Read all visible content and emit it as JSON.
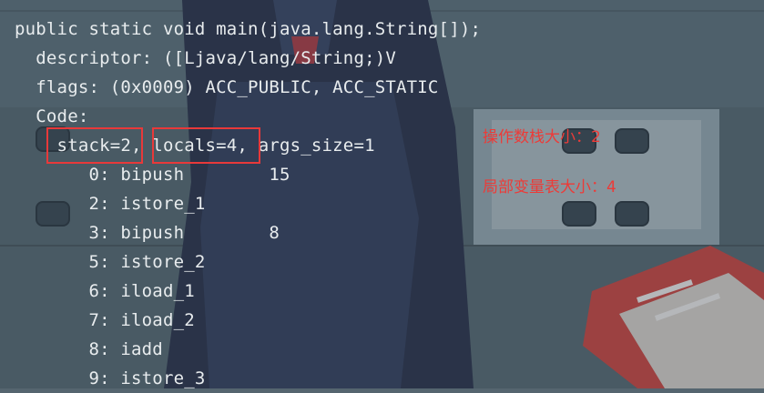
{
  "code": {
    "lines": [
      "public static void main(java.lang.String[]);",
      "  descriptor: ([Ljava/lang/String;)V",
      "  flags: (0x0009) ACC_PUBLIC, ACC_STATIC",
      "  Code:",
      "    stack=2, locals=4, args_size=1",
      "       0: bipush        15",
      "       2: istore_1",
      "       3: bipush        8",
      "       5: istore_2",
      "       6: iload_1",
      "       7: iload_2",
      "       8: iadd",
      "       9: istore_3"
    ]
  },
  "annotations": {
    "operand_stack": "操作数栈大小：2",
    "local_vars": "局部变量表大小：4"
  },
  "colors": {
    "highlight": "#e8393a",
    "annotation_text": "#ec3b38",
    "code_text": "#e8ecee"
  }
}
